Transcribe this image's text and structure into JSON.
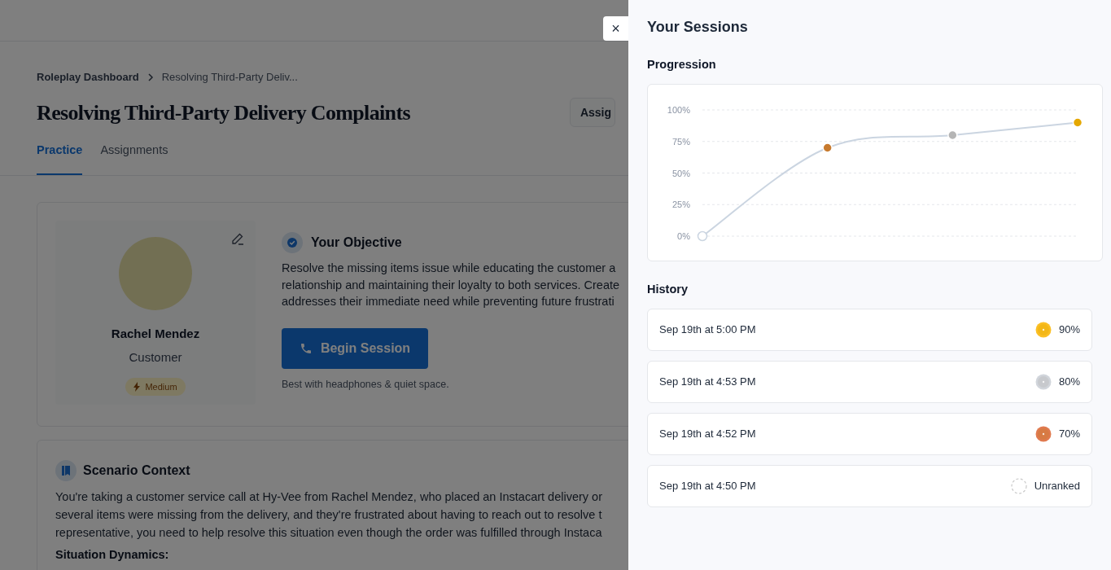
{
  "breadcrumb": [
    {
      "label": "Roleplay Dashboard"
    },
    {
      "label": "Resolving Third-Party Deliv..."
    }
  ],
  "page_title": "Resolving Third-Party Delivery Complaints",
  "header_button": "Assig",
  "tabs": [
    {
      "label": "Practice",
      "selected": true
    },
    {
      "label": "Assignments",
      "selected": false
    }
  ],
  "persona": {
    "name": "Rachel Mendez",
    "role": "Customer",
    "difficulty": "Medium"
  },
  "objective": {
    "title": "Your Objective",
    "lines": [
      "Resolve the missing items issue while educating the customer a",
      "relationship and maintaining their loyalty to both services. Create",
      "addresses their immediate need while preventing future frustrati"
    ],
    "button": "Begin Session",
    "hint": "Best with headphones & quiet space."
  },
  "context": {
    "title": "Scenario Context",
    "lines": [
      "You're taking a customer service call at Hy-Vee from Rachel Mendez, who placed an Instacart delivery or",
      "several items were missing from the delivery, and they're frustrated about having to reach out to resolve t",
      "representative, you need to help resolve this situation even though the order was fulfilled through Instaca"
    ],
    "subheading": "Situation Dynamics:"
  },
  "drawer": {
    "close": "×",
    "title": "Your Sessions",
    "progression_title": "Progression",
    "chart_data": {
      "type": "line",
      "grid": true,
      "yticks": [
        {
          "value": 0,
          "label": "0%"
        },
        {
          "value": 25,
          "label": "25%"
        },
        {
          "value": 50,
          "label": "50%"
        },
        {
          "value": 75,
          "label": "75%"
        },
        {
          "value": 100,
          "label": "100%"
        }
      ],
      "ylim": [
        0,
        100
      ],
      "series": [
        {
          "color": "#cbd5e1",
          "marker": true,
          "values": [
            0,
            70,
            80,
            90
          ]
        }
      ]
    },
    "history_title": "History",
    "history": [
      {
        "time": "Sep 19th at 5:00 PM",
        "kind": "gold",
        "score": "90%"
      },
      {
        "time": "Sep 19th at 4:53 PM",
        "kind": "silver",
        "score": "80%"
      },
      {
        "time": "Sep 19th at 4:52 PM",
        "kind": "bronze",
        "score": "70%"
      },
      {
        "time": "Sep 19th at 4:50 PM",
        "kind": "unranked",
        "score": "Unranked"
      }
    ]
  }
}
